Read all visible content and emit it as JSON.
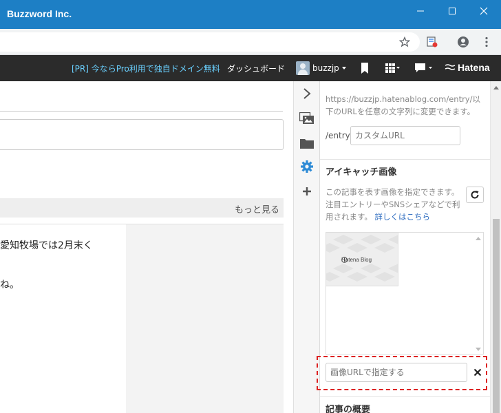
{
  "window": {
    "title": "Buzzword Inc.",
    "controls": {
      "minimize_icon": "minimize-icon",
      "maximize_icon": "maximize-icon",
      "close_icon": "close-icon"
    }
  },
  "browser": {
    "toolbar_icons": [
      "star-icon",
      "extension-icon",
      "account-icon",
      "menu-icon"
    ]
  },
  "hatena_bar": {
    "pr_link": "[PR] 今ならPro利用で独自ドメイン無料",
    "dashboard": "ダッシュボード",
    "username": "buzzjp",
    "icons": [
      "bookmark-icon",
      "apps-grid-icon",
      "comment-icon"
    ],
    "logo": "Hatena"
  },
  "editor": {
    "more_link": "もっと見る",
    "body_lines": [
      "愛知牧場では2月末く",
      "ね。"
    ]
  },
  "tool_strip": {
    "items": [
      "collapse-chevron-icon",
      "image-icon",
      "folder-icon",
      "settings-gear-icon",
      "plus-icon"
    ]
  },
  "sidebar": {
    "url_note": "https://buzzjp.hatenablog.com/entry/以下のURLを任意の文字列に変更できます。",
    "entry_prefix": "/entry/",
    "custom_url_placeholder": "カスタムURL",
    "eyecatch": {
      "heading": "アイキャッチ画像",
      "description": "この記事を表す画像を指定できます。注目エントリーやSNSシェアなどで利用されます。",
      "link": "詳しくはこちら",
      "thumbnail_label": "Hatena Blog",
      "image_url_placeholder": "画像URLで指定する"
    },
    "summary_heading": "記事の概要"
  },
  "colors": {
    "titlebar": "#1d7fc5",
    "hatena_bar": "#2b2b2b",
    "pr_link": "#6ad0ff",
    "highlight": "#dd2222",
    "gear": "#2e8bd6"
  }
}
